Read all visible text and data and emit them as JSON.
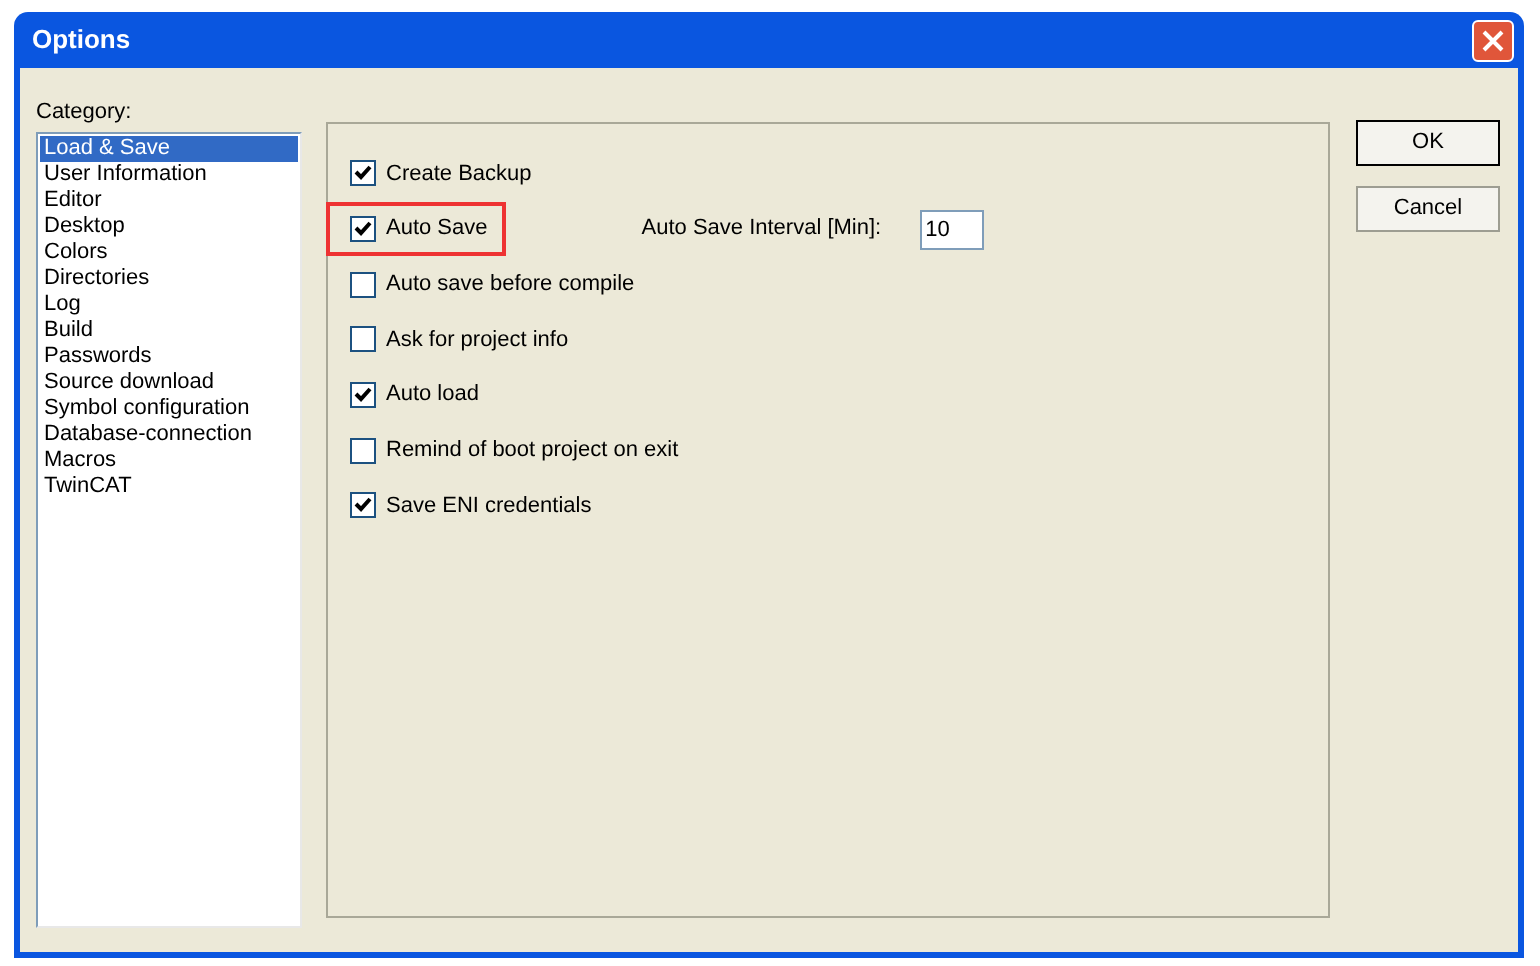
{
  "window": {
    "title": "Options"
  },
  "category": {
    "label": "Category:",
    "items": [
      {
        "label": "Load & Save",
        "selected": true
      },
      {
        "label": "User Information",
        "selected": false
      },
      {
        "label": "Editor",
        "selected": false
      },
      {
        "label": "Desktop",
        "selected": false
      },
      {
        "label": "Colors",
        "selected": false
      },
      {
        "label": "Directories",
        "selected": false
      },
      {
        "label": "Log",
        "selected": false
      },
      {
        "label": "Build",
        "selected": false
      },
      {
        "label": "Passwords",
        "selected": false
      },
      {
        "label": "Source download",
        "selected": false
      },
      {
        "label": "Symbol configuration",
        "selected": false
      },
      {
        "label": "Database-connection",
        "selected": false
      },
      {
        "label": "Macros",
        "selected": false
      },
      {
        "label": "TwinCAT",
        "selected": false
      }
    ]
  },
  "options": [
    {
      "label": "Create Backup",
      "checked": true,
      "highlighted": false
    },
    {
      "label": "Auto Save",
      "checked": true,
      "highlighted": true,
      "interval": {
        "label": "Auto Save Interval [Min]:",
        "value": "10"
      }
    },
    {
      "label": "Auto save before compile",
      "checked": false,
      "highlighted": false
    },
    {
      "label": "Ask for project info",
      "checked": false,
      "highlighted": false
    },
    {
      "label": "Auto load",
      "checked": true,
      "highlighted": false
    },
    {
      "label": "Remind of boot project on exit",
      "checked": false,
      "highlighted": false
    },
    {
      "label": "Save ENI credentials",
      "checked": true,
      "highlighted": false
    }
  ],
  "buttons": [
    {
      "label": "OK",
      "default": true
    },
    {
      "label": "Cancel",
      "default": false
    }
  ]
}
